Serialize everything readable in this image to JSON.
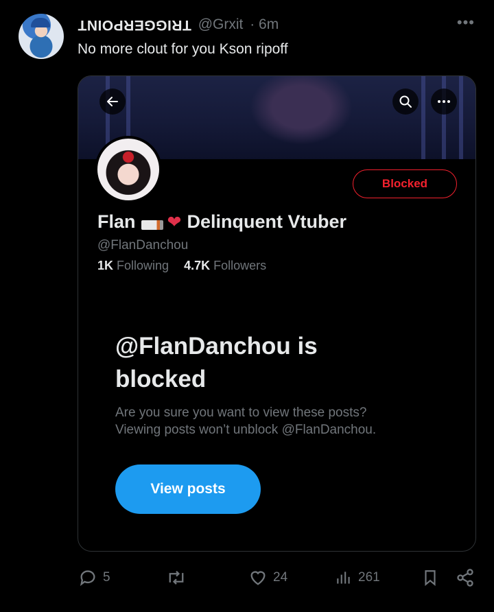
{
  "tweet": {
    "author_display_name": "TRIGGERPOINT",
    "author_handle": "@Grxit",
    "time": "· 6m",
    "text": "No more clout for you Kson ripoff"
  },
  "screenshot": {
    "profile": {
      "name": "Flan",
      "name_suffix": "Delinquent Vtuber",
      "handle": "@FlanDanchou",
      "following_count": "1K",
      "following_label": "Following",
      "followers_count": "4.7K",
      "followers_label": "Followers",
      "blocked_button_label": "Blocked"
    },
    "blocked_title": "@FlanDanchou is blocked",
    "blocked_desc_line1": "Are you sure you want to view these posts?",
    "blocked_desc_line2": "Viewing posts won’t unblock @FlanDanchou.",
    "view_posts_label": "View posts"
  },
  "actions": {
    "replies": "5",
    "retweets": "",
    "likes": "24",
    "views": "261"
  },
  "colors": {
    "accent_blue": "#1d9bf0",
    "blocked_red": "#f4212e",
    "muted_text": "#71767b",
    "primary_text": "#e7e9ea"
  },
  "icons": [
    "back-arrow-icon",
    "search-icon",
    "more-icon",
    "reply-icon",
    "retweet-icon",
    "like-icon",
    "views-icon",
    "bookmark-icon",
    "share-icon"
  ]
}
